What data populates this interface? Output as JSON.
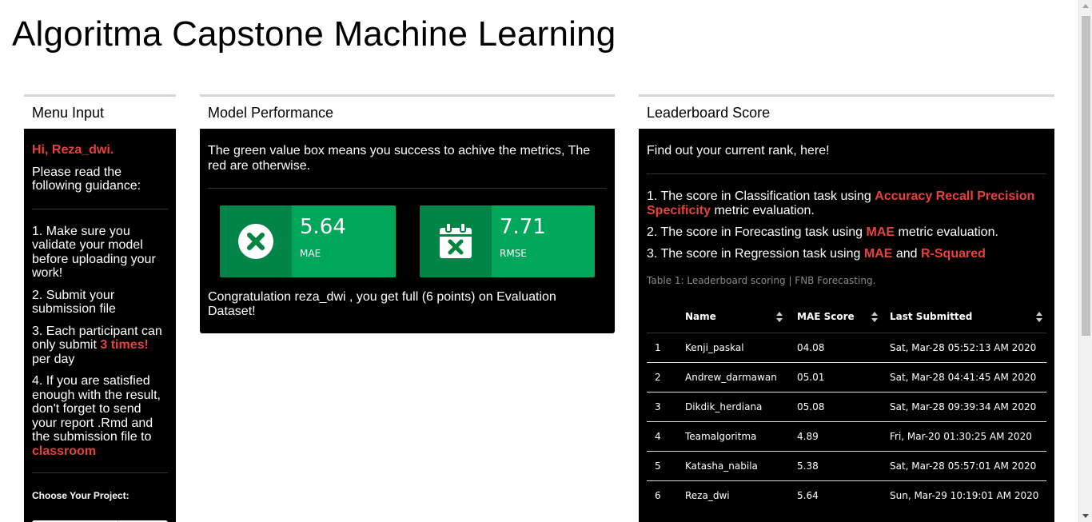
{
  "title": "Algoritma Capstone Machine Learning",
  "menu": {
    "header": "Menu Input",
    "greeting": "Hi, Reza_dwi.",
    "intro": "Please read the following guidance:",
    "item1": "1. Make sure you validate your model before uploading your work!",
    "item2": "2. Submit your submission file",
    "item3_pre": "3. Each participant can only submit ",
    "item3_emph": "3 times!",
    "item3_post": " per day",
    "item4_pre": "4. If you are satisfied enough with the result, don't forget to send your report .Rmd and the submission file to ",
    "item4_emph": "classroom",
    "choose_label": "Choose Your Project:"
  },
  "model": {
    "header": "Model Performance",
    "note": "The green value box means you success to achive the metrics, The red are otherwise.",
    "boxes": [
      {
        "value": "5.64",
        "label": "MAE",
        "icon": "times-circle-icon",
        "color": "#00a65a"
      },
      {
        "value": "7.71",
        "label": "RMSE",
        "icon": "calendar-times-icon",
        "color": "#00a65a"
      }
    ],
    "congrats": "Congratulation reza_dwi , you get full (6 points) on Evaluation Dataset!"
  },
  "leaderboard": {
    "header": "Leaderboard Score",
    "intro": "Find out your current rank, here!",
    "p1_pre": "1. The score in Classification task using ",
    "p1_emph": "Accuracy Recall Precision Specificity",
    "p1_post": " metric evaluation.",
    "p2_pre": "2. The score in Forecasting task using ",
    "p2_emph": "MAE",
    "p2_post": " metric evaluation.",
    "p3_pre": "3. The score in Regression task using ",
    "p3_emph1": "MAE",
    "p3_mid": " and ",
    "p3_emph2": "R-Squared",
    "caption": "Table 1: Leaderboard scoring | FNB Forecasting.",
    "columns": [
      "",
      "Name",
      "MAE Score",
      "Last Submitted"
    ],
    "rows": [
      [
        "1",
        "Kenji_paskal",
        "04.08",
        "Sat, Mar-28 05:52:13 AM 2020"
      ],
      [
        "2",
        "Andrew_darmawan",
        "05.01",
        "Sat, Mar-28 04:41:45 AM 2020"
      ],
      [
        "3",
        "Dikdik_herdiana",
        "05.08",
        "Sat, Mar-28 09:39:34 AM 2020"
      ],
      [
        "4",
        "Teamalgoritma",
        "4.89",
        "Fri, Mar-20 01:30:25 AM 2020"
      ],
      [
        "5",
        "Katasha_nabila",
        "5.38",
        "Sat, Mar-28 05:57:01 AM 2020"
      ],
      [
        "6",
        "Reza_dwi",
        "5.64",
        "Sun, Mar-29 10:19:01 AM 2020"
      ]
    ],
    "accent": "#e8413b"
  }
}
